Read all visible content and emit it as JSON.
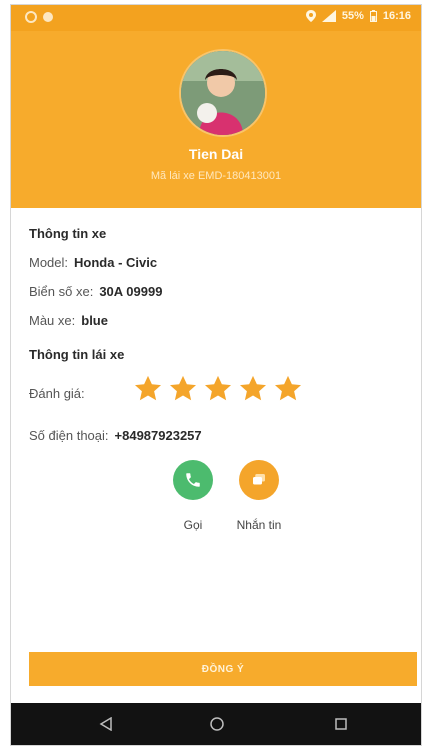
{
  "status_bar": {
    "battery": "55%",
    "time": "16:16"
  },
  "profile": {
    "name": "Tien Dai",
    "driver_code": "Mã lái xe EMD-180413001"
  },
  "vehicle": {
    "section_title": "Thông tin xe",
    "model_label": "Model:",
    "model_value": "Honda - Civic",
    "plate_label": "Biển số xe:",
    "plate_value": "30A 09999",
    "color_label": "Màu xe:",
    "color_value": "blue"
  },
  "driver": {
    "section_title": "Thông tin lái xe",
    "rating_label": "Đánh giá:",
    "rating_value": 5,
    "rating_max": 5,
    "phone_label": "Số điện thoại:",
    "phone_value": "+84987923257"
  },
  "actions": {
    "call_label": "Gọi",
    "message_label": "Nhắn tin"
  },
  "footer": {
    "agree_label": "ĐỒNG Ý"
  },
  "colors": {
    "accent": "#f7ab2c",
    "call": "#4cbb6e",
    "star": "#f4a52b"
  }
}
